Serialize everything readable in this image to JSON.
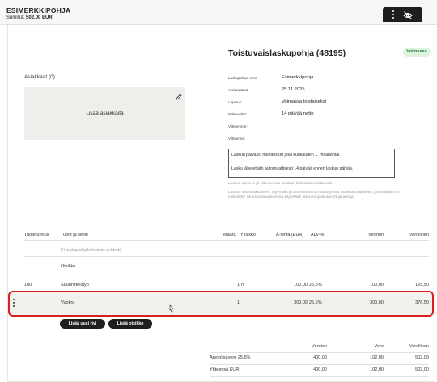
{
  "header": {
    "title": "ESIMERKKIPOHJA",
    "sum_label": "Summa:",
    "sum_value": "502,00 EUR"
  },
  "toolbar": {
    "icons": [
      "more-vertical-icon",
      "eye-off-icon"
    ]
  },
  "document": {
    "title": "Toistuvaislaskupohja (48195)",
    "status": "Voimassa",
    "status_color": "#217a34"
  },
  "customers": {
    "label": "Asiakkaat (0)",
    "add_label": "Lisää asiakkaita"
  },
  "info": [
    {
      "label": "Laskupohjan nimi:",
      "value": "Esimerkkipohja"
    },
    {
      "label": "Aloituspäivä:",
      "value": "25.11.2025"
    },
    {
      "label": "Lopetus:",
      "value": "Voimassa toistaiseksi"
    },
    {
      "label": "Maksuehto:",
      "value": "14 päivää netto"
    },
    {
      "label": "Viitteemme:",
      "value": ""
    },
    {
      "label": "Viitteenne:",
      "value": ""
    }
  ],
  "notice": {
    "line1": "Laskun päiväksi muodostuu joka kuukauden 1. maanantai.",
    "line2": "Lasku lähetetään automaattisesti 14 päivää ennen laskun päivää."
  },
  "hints": {
    "line1": "Laskun numero ja viitenumero luodaan laskua lähetettäessä.",
    "line2": "Laskun seurantakohteet, myyntitilit ja arvonlisäverot määräytyvät asiakaskohtaisesti, jos sellaiset on",
    "line3": "määritelty. Muussa tapauksessa käytetään laskupohjalla annettuja arvoja."
  },
  "table": {
    "headers": {
      "code": "Tuotetunnus",
      "product": "Tuote ja selite",
      "qty": "Määrä",
      "unit": "Yksikkö",
      "price": "À-hinta (EUR)",
      "vat": "ALV-%",
      "net": "Veroton",
      "gross": "Verollinen"
    },
    "note_row": "Ei laskupohjakohtaista selitettä",
    "heading_row": "Otsikko",
    "rows": [
      {
        "code": "100",
        "product": "Suunnittelutyö",
        "qty": "1",
        "unit": "h",
        "price": "100,00",
        "vat": "25,5%",
        "net": "100,00",
        "gross": "125,50"
      },
      {
        "code": "",
        "product": "Vuokra",
        "qty": "1",
        "unit": "",
        "price": "300,00",
        "vat": "25,5%",
        "net": "300,00",
        "gross": "376,50"
      }
    ]
  },
  "buttons": {
    "add_row": "Lisää uusi rivi",
    "add_heading": "Lisää otsikko"
  },
  "summary": {
    "headers": {
      "net": "Veroton",
      "tax": "Vero",
      "gross": "Verollinen"
    },
    "rows": [
      {
        "label": "Arvonlisävero 25,5%",
        "net": "400,00",
        "tax": "102,00",
        "gross": "502,00"
      },
      {
        "label": "Yhteensä EUR",
        "net": "400,00",
        "tax": "102,00",
        "gross": "502,00"
      }
    ]
  }
}
